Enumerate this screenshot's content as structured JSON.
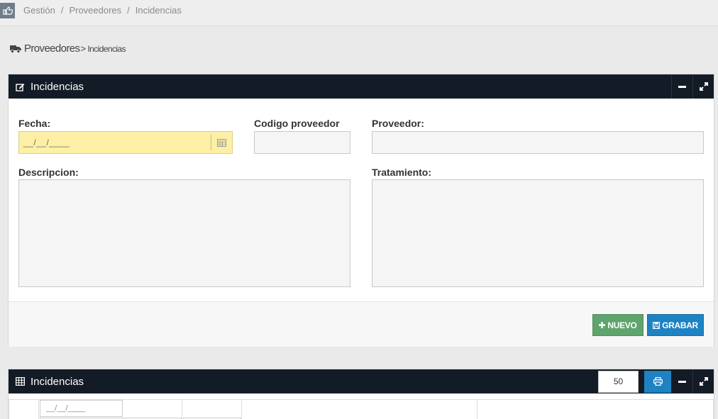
{
  "breadcrumb": {
    "items": [
      "Gestión",
      "Proveedores",
      "Incidencias"
    ]
  },
  "page_heading": {
    "main": "Proveedores",
    "sub": "Incidencias"
  },
  "form_widget": {
    "title": "Incidencias",
    "fields": {
      "fecha_label": "Fecha:",
      "fecha_placeholder": "__/__/____",
      "codigo_label": "Codigo proveedor",
      "proveedor_label": "Proveedor:",
      "descripcion_label": "Descripcion:",
      "tratamiento_label": "Tratamiento:"
    },
    "buttons": {
      "nuevo": "NUEVO",
      "grabar": "GRABAR"
    }
  },
  "table_widget": {
    "title": "Incidencias",
    "page_size": "50",
    "date_filter_placeholder": "__/__/____"
  },
  "colors": {
    "header_dark": "#131c26",
    "green_button": "#5ea46c",
    "blue_button": "#1e82c3",
    "date_field": "#fdf0a6"
  }
}
